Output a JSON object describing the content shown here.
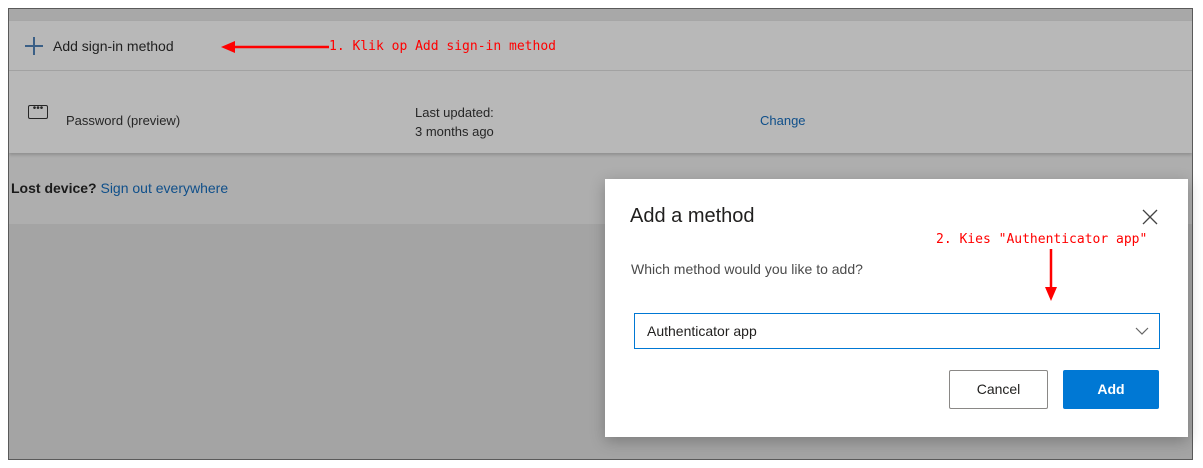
{
  "colors": {
    "backdrop": "#aeaeae",
    "link": "#0f4f8a",
    "primary": "#0078d4",
    "annotation": "#ff0000"
  },
  "signin": {
    "add_label": "Add sign-in method",
    "add_icon": "plus-icon",
    "password_icon": "dots-icon",
    "password_label": "Password (preview)",
    "last_updated_label": "Last updated:",
    "last_updated_value": "3 months ago",
    "change_label": "Change"
  },
  "lost_device": {
    "prefix": "Lost device?",
    "link": "Sign out everywhere"
  },
  "annotations": {
    "step1": "1. Klik op Add sign-in method",
    "step2": "2. Kies \"Authenticator app\""
  },
  "dialog": {
    "title": "Add a method",
    "question": "Which method would you like to add?",
    "selected_method": "Authenticator app",
    "cancel_label": "Cancel",
    "add_label": "Add",
    "close_icon": "close-icon",
    "chevron_icon": "chevron-down-icon"
  }
}
